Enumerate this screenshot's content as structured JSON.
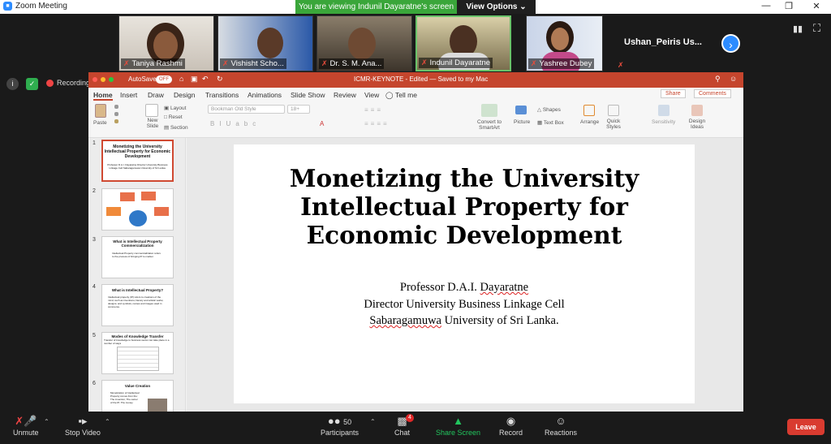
{
  "window": {
    "title": "Zoom Meeting",
    "banner": "You are viewing Indunil Dayaratne's screen",
    "view_options": "View Options"
  },
  "participants": [
    {
      "name": "Taniya Rashmi"
    },
    {
      "name": "Vishisht Scho..."
    },
    {
      "name": "Dr. S. M. Ana..."
    },
    {
      "name": "Indunil Dayaratne"
    },
    {
      "name": "Yashree Dubey"
    },
    {
      "name": "Ushan_Peiris Us..."
    }
  ],
  "recording": {
    "label": "Recording"
  },
  "ppt": {
    "autosave": "AutoSave",
    "autosave_state": "OFF",
    "doc_title": "ICMR-KEYNOTE - Edited — Saved to my Mac",
    "tabs": [
      "Home",
      "Insert",
      "Draw",
      "Design",
      "Transitions",
      "Animations",
      "Slide Show",
      "Review",
      "View"
    ],
    "tell_me": "Tell me",
    "share": "Share",
    "comments": "Comments",
    "ribbon": {
      "paste": "Paste",
      "new_slide": "New Slide",
      "layout": "Layout",
      "reset": "Reset",
      "section": "Section",
      "font": "Bookman Old Style",
      "size": "18+",
      "convert_smartart": "Convert to SmartArt",
      "picture": "Picture",
      "shapes": "Shapes",
      "text_box": "Text Box",
      "arrange": "Arrange",
      "quick_styles": "Quick Styles",
      "sensitivity": "Sensitivity",
      "design_ideas": "Design Ideas"
    },
    "thumbnails": [
      {
        "num": "1",
        "title": "Monetizing the University Intellectual Property for Economic Development",
        "sub": "Professor D.A.I. Dayaratne Director University Business Linkage Cell Sabaragamuwa University of Sri Lanka."
      },
      {
        "num": "2",
        "title": "",
        "sub": ""
      },
      {
        "num": "3",
        "title": "What is Intellectual Property Commercialization",
        "sub": "Intellectual Property commercialization refers to the process of bringing IP to market"
      },
      {
        "num": "4",
        "title": "What is Intellectual Property?",
        "sub": "Intellectual property (IP) refers to creations of the mind, such as inventions; literary and artistic works; designs; and symbols, names and images used in commerce."
      },
      {
        "num": "5",
        "title": "Modes of Knowledge Transfer",
        "sub": "Transfer of knowledge to business sector can take place in a number of ways"
      },
      {
        "num": "6",
        "title": "Value Creation",
        "sub": "Monetization of Intellectual Property comes from the: The invention; The owner of the IP; The money"
      }
    ],
    "slide": {
      "title": "Monetizing the University Intellectual Property for Economic Development",
      "name_prefix": "Professor D.A.I. ",
      "name_underlined": "Dayaratne",
      "line2": "Director University Business Linkage Cell",
      "line3_underlined": "Sabaragamuwa",
      "line3_rest": " University of Sri Lanka."
    }
  },
  "toolbar": {
    "unmute": "Unmute",
    "stop_video": "Stop Video",
    "participants": "Participants",
    "participants_count": "50",
    "chat": "Chat",
    "chat_badge": "4",
    "share_screen": "Share Screen",
    "record": "Record",
    "reactions": "Reactions",
    "leave": "Leave"
  },
  "colors": {
    "ppt_accent": "#c5452d",
    "zoom_blue": "#2d8cff",
    "banner_green": "#3aa63a",
    "leave_red": "#d93b30",
    "share_green": "#22c55e"
  }
}
